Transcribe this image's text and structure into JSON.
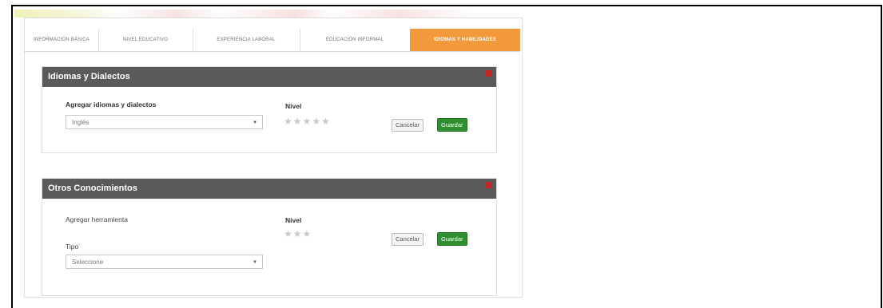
{
  "tabs": [
    {
      "label": "INFORMACIÓN BÁSICA"
    },
    {
      "label": "NIVEL EDUCATIVO"
    },
    {
      "label": "EXPERIENCIA LABORAL"
    },
    {
      "label": "EDUCACIÓN INFORMAL"
    },
    {
      "label": "IDIOMAS Y HABILIDADES"
    }
  ],
  "active_tab": "IDIOMAS Y HABILIDADES",
  "languages_panel": {
    "title": "Idiomas y Dialectos",
    "field_label": "Agregar idiomas y dialectos",
    "select_value": "Inglés",
    "level_label": "Nivel",
    "stars": "★★★★★",
    "cancel_label": "Cancelar",
    "save_label": "Guardar"
  },
  "knowledge_panel": {
    "title": "Otros Conocimientos",
    "field_label": "Agregar herramienta",
    "type_label": "Tipo",
    "select_placeholder": "Seleccione",
    "level_label": "Nivel",
    "stars": "★★★",
    "cancel_label": "Cancelar",
    "save_label": "Guardar"
  },
  "colors": {
    "active_tab": "#f29a3b",
    "panel_header": "#5a5a5a",
    "save_button": "#2f8f2f",
    "close_icon": "#c52525"
  },
  "icons": {
    "dropdown": "▼",
    "close": "close-icon",
    "rating": "star-icon"
  }
}
